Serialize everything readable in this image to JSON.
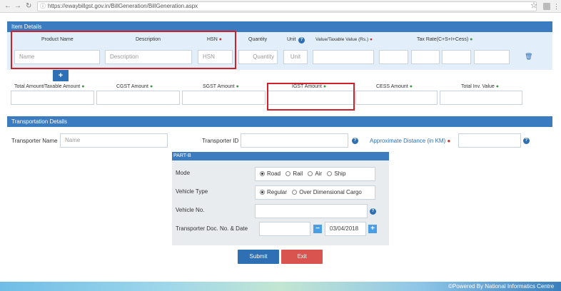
{
  "browser": {
    "url": "https://ewaybillgst.gov.in/BillGeneration/BillGeneration.aspx"
  },
  "item_details": {
    "header": "Item Details",
    "labels": {
      "product_name": "Product Name",
      "description": "Description",
      "hsn": "HSN",
      "quantity": "Quantity",
      "unit": "Unit",
      "value": "Value/Taxable Value (Rs.)",
      "tax_rate": "Tax Rate(C+S+I+Cess)"
    },
    "placeholders": {
      "name": "Name",
      "description": "Description",
      "hsn": "HSN",
      "quantity": "Quantity",
      "unit": "Unit"
    },
    "add_button": "+"
  },
  "totals": {
    "total_amount": "Total Amount/Taxable Amount",
    "cgst": "CGST Amount",
    "sgst": "SGST Amount",
    "igst": "IGST Amount",
    "cess": "CESS Amount",
    "total_inv": "Total Inv. Value"
  },
  "transport": {
    "header": "Transportation Details",
    "transporter_name": "Transporter Name",
    "name_placeholder": "Name",
    "transporter_id": "Transporter ID",
    "distance": "Approximate Distance (in KM)"
  },
  "partb": {
    "header": "PART-B",
    "mode_label": "Mode",
    "mode_options": [
      "Road",
      "Rail",
      "Air",
      "Ship"
    ],
    "vehicle_type_label": "Vehicle Type",
    "vehicle_options": [
      "Regular",
      "Over Dimensional Cargo"
    ],
    "vehicle_no_label": "Vehicle No.",
    "doc_label": "Transporter Doc. No. & Date",
    "date": "03/04/2018"
  },
  "actions": {
    "submit": "Submit",
    "exit": "Exit"
  },
  "footer": {
    "text": "©Powered By National Informatics Centre"
  },
  "colors": {
    "primary": "#3b7bbf",
    "danger": "#d9534f",
    "highlight": "#d0202a",
    "required_red": "#c0392b",
    "required_green": "#3d9a46"
  }
}
